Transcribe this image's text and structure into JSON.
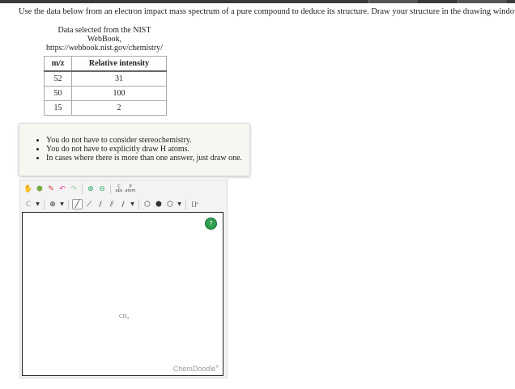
{
  "question": "Use the data below from an electron impact mass spectrum of a pure compound to deduce its structure. Draw your structure in the drawing window.",
  "source": {
    "line1": "Data selected from the NIST",
    "line2": "WebBook,",
    "line3": "https://webbook.nist.gov/chemistry/"
  },
  "table": {
    "headers": [
      "m/z",
      "Relative intensity"
    ],
    "rows": [
      [
        "52",
        "31"
      ],
      [
        "50",
        "100"
      ],
      [
        "15",
        "2"
      ]
    ]
  },
  "notes": [
    "You do not have to consider stereochemistry.",
    "You do not have to explicitly draw H atoms.",
    "In cases where there is more than one answer, just draw one."
  ],
  "editor": {
    "canvas_label": "CH₄",
    "brand": "ChemDoodle",
    "brand_mark": "®",
    "help_glyph": "?",
    "text_tool_top": "C",
    "text_tool_bottom": "abc",
    "text_tool2_top": "P",
    "text_tool2_bottom": "atom",
    "ring_label": "[]ⁿ"
  },
  "colors": {
    "help_green": "#2e9e4f",
    "brand_gray": "#999999"
  }
}
